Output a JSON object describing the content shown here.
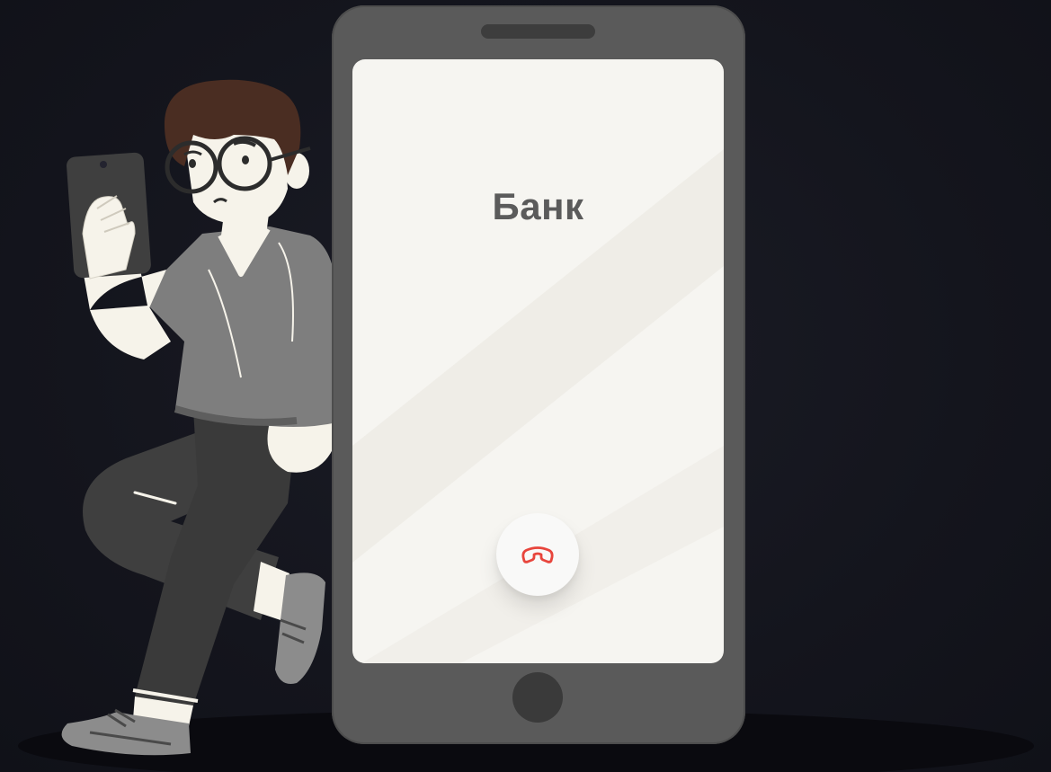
{
  "call_screen": {
    "caller_name": "Банк",
    "end_call_icon": "phone-hangup-icon",
    "end_call_color": "#e8453c"
  },
  "illustration": {
    "figure": "person-holding-phone",
    "background_color": "#14151d",
    "phone_body_color": "#5a5a5a",
    "screen_color": "#f6f5f1"
  }
}
